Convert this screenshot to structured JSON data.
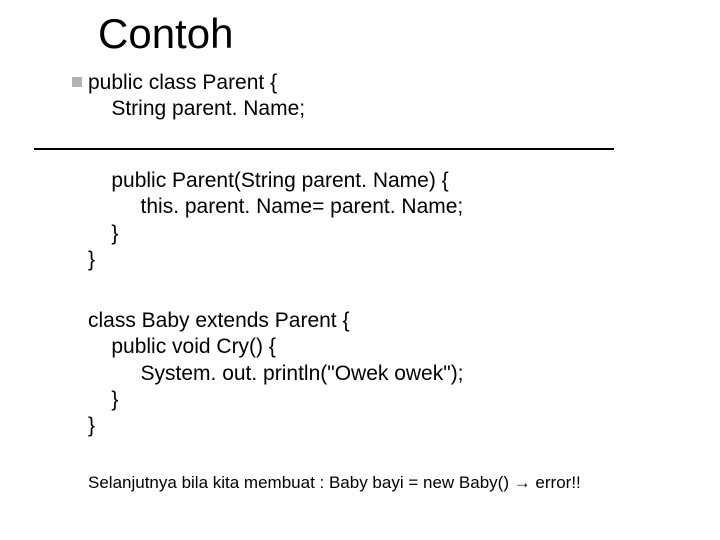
{
  "title": "Contoh",
  "code": {
    "block1": "public class Parent {\n    String parent. Name;",
    "block2": "    public Parent(String parent. Name) {\n         this. parent. Name= parent. Name;\n    }\n}",
    "block3": "class Baby extends Parent {\n    public void Cry() {\n         System. out. println(\"Owek owek\");\n    }\n}"
  },
  "footnote": {
    "prefix": "Selanjutnya bila kita membuat : Baby bayi = new Baby() ",
    "arrow": "→",
    "suffix": " error!!"
  }
}
